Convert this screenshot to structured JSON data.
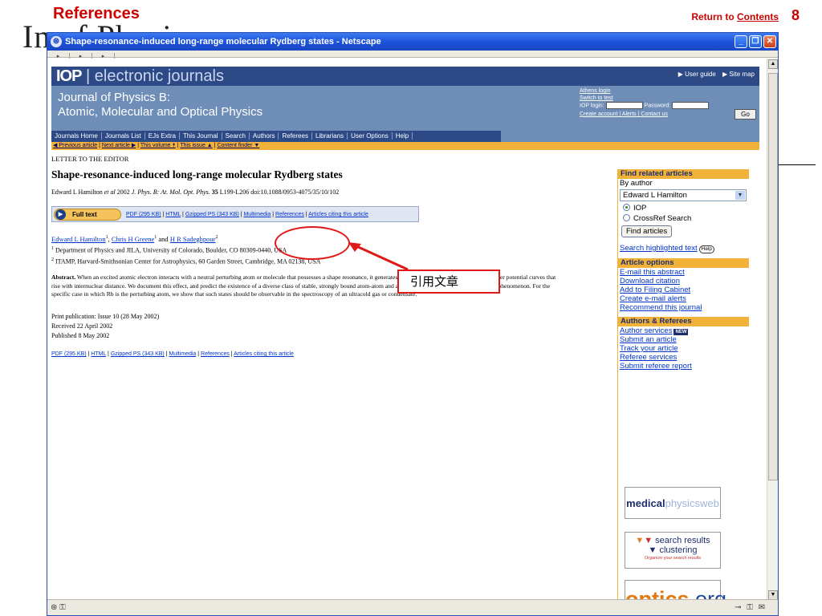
{
  "slide": {
    "title": "References",
    "ghost_title": "In          of Physics",
    "return_prefix": "Return to ",
    "return_link": "Contents",
    "page_number": "8"
  },
  "window": {
    "title": "Shape-resonance-induced long-range molecular Rydberg states - Netscape",
    "nav_glyphs": [
      "▸",
      "▸",
      "▸"
    ]
  },
  "banner": {
    "brand_bold": "IOP",
    "brand_rest": " | electronic journals",
    "user_guide": "▶ User guide",
    "site_map": "▶ Site map",
    "journal_line1": "Journal of Physics B:",
    "journal_line2": "Atomic, Molecular and Optical Physics",
    "athens_login": "Athens login",
    "switch_to_test": "Switch to test",
    "iop_login_label": "IOP login:",
    "password_label": "Password:",
    "go_label": "Go",
    "account_links": "Create account | Alerts | Contact us",
    "menu": [
      "Journals Home",
      "Journals List",
      "EJs Extra",
      "This Journal",
      "Search",
      "Authors",
      "Referees",
      "Librarians",
      "User Options",
      "Help"
    ]
  },
  "crumbs": {
    "prev": "◀ Previous article",
    "next": "Next article ▶",
    "volume": "This volume ⯭",
    "issue": "This issue ▲",
    "finder": "Content finder ▼"
  },
  "article": {
    "label": "LETTER TO THE EDITOR",
    "title": "Shape-resonance-induced long-range molecular Rydberg states",
    "citation_author": "Edward L Hamilton ",
    "citation_etal": "et al",
    "citation_year": " 2002 ",
    "citation_journal": "J. Phys. B: At. Mol. Opt. Phys.",
    "citation_volume": " 35",
    "citation_pages": " L199-L206   doi:10.1088/0953-4075/35/10/102",
    "fulltext_label": "Full text",
    "format_links": [
      "PDF (295 KB)",
      "HTML",
      "Gzipped PS (343 KB)",
      "Multimedia",
      "References",
      "Articles citing this article"
    ],
    "author1": "Edward L Hamilton",
    "author2": "Chris H Greene",
    "author3": "H R Sadeghpour",
    "and": " and ",
    "sup1": "1",
    "sup2": "2",
    "affil1": " Department of Physics and JILA, University of Colorado, Boulder, CO 80309-0440, USA",
    "affil2": " ITAMP, Harvard-Smithsonian Center for Astrophysics, 60 Garden Street, Cambridge, MA 02138, USA",
    "abstract_label": "Abstract.",
    "abstract_text": " When an excited atomic electron interacts with a neutral perturbing atom or molecule that possesses a shape resonance, it generates a characteristic class of Born-Oppenheimer potential curves that rise with internuclear distance. We document this effect, and predict the existence of a diverse class of stable, strongly bound atom-atom and atom-molecule states that result from this phenomenon. For the specific case in which Rb is the perturbing atom, we show that such states should be observable in the spectroscopy of an ultracold gas or condensate.",
    "print_pub": "Print publication: Issue 10 (28 May 2002)",
    "received": "Received 22 April 2002",
    "published": "Published 8 May 2002"
  },
  "sidebar": {
    "related_head": "Find related articles",
    "by_author": "By author",
    "author_selected": "Edward L Hamilton",
    "radio_iop": "IOP",
    "radio_crossref": "CrossRef Search",
    "find_button": "Find articles",
    "search_highlighted": "Search highlighted text",
    "help_badge": "Help",
    "options_head": "Article options",
    "options": [
      "E-mail this abstract",
      "Download citation",
      "Add to Filing Cabinet",
      "Create e-mail alerts",
      "Recommend this journal"
    ],
    "authors_head": "Authors & Referees",
    "author_services": "Author services",
    "new_badge": "NEW",
    "authors_links": [
      "Submit an article",
      "Track your article",
      "Referee services",
      "Submit referee report"
    ],
    "ad_medphys_a": "medical",
    "ad_medphys_b": "physics",
    "ad_medphys_c": "web",
    "ad_clustering_line1": "search results",
    "ad_clustering_line2": "clustering",
    "ad_clustering_sub": "Organize your search results",
    "ad_optics_a": "optics",
    "ad_optics_b": ".org"
  },
  "annotation": {
    "callout_text": "引用文章",
    "color": "#e01818"
  },
  "statusbar": {
    "left": "⊛ ⚿",
    "right": "⊸ ⚿ ✉"
  },
  "colors": {
    "banner_dark": "#2d4a86",
    "banner_mid": "#6e8eb8",
    "accent_orange": "#f2b23a",
    "slide_red": "#cc0000"
  }
}
